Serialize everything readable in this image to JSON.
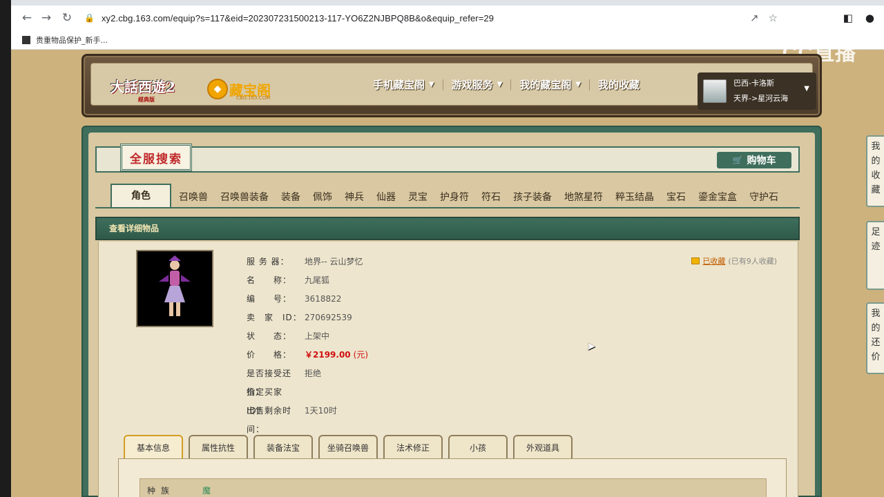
{
  "browser": {
    "url": "xy2.cbg.163.com/equip?s=117&eid=202307231500213-117-YO6Z2NJBPQ8B&o&equip_refer=29",
    "bookmark": "贵重物品保护_新手..."
  },
  "watermark": "CC直播",
  "header": {
    "logo_game": "大話西遊2",
    "logo_game_sub": "經典版",
    "logo_cbg": "藏宝阁",
    "logo_cbg_sub": "CBG.163.COM",
    "nav": [
      "手机藏宝阁",
      "游戏服务",
      "我的藏宝阁",
      "我的收藏"
    ],
    "user_name": "巴西-卡洛斯",
    "user_server": "天界->星河云海"
  },
  "search": {
    "title": "全服搜索",
    "cart": "购物车"
  },
  "categories": [
    "角色",
    "召唤兽",
    "召唤兽装备",
    "装备",
    "佩饰",
    "神兵",
    "仙器",
    "灵宝",
    "护身符",
    "符石",
    "孩子装备",
    "地煞星符",
    "粹玉结晶",
    "宝石",
    "鎏金宝盒",
    "守护石"
  ],
  "detail": {
    "header": "查看详细物品",
    "fields": [
      {
        "label": "服 务 器：",
        "value": "地界-- 云山梦忆"
      },
      {
        "label": "名　　称：",
        "value": "九尾狐"
      },
      {
        "label": "编　　号：",
        "value": "3618822"
      },
      {
        "label": "卖　家　ID：",
        "value": "270692539"
      },
      {
        "label": "状　　态：",
        "value": "上架中"
      },
      {
        "label": "价　　格：",
        "value": "￥2199.00"
      },
      {
        "label": "是否接受还价：",
        "value": "拒绝"
      },
      {
        "label": "指定买家 ID：",
        "value": ""
      },
      {
        "label": "出售剩余时间：",
        "value": "1天10时"
      }
    ],
    "price_unit": "(元)",
    "fav_link": "已收藏",
    "fav_count": "(已有9人收藏)"
  },
  "sub_tabs": [
    "基本信息",
    "属性抗性",
    "装备法宝",
    "坐骑召唤兽",
    "法术修正",
    "小孩",
    "外观道具"
  ],
  "attr": {
    "label": "种族",
    "value": "魔"
  },
  "side_buttons": [
    "我的收藏",
    "足迹",
    "我的还价"
  ]
}
